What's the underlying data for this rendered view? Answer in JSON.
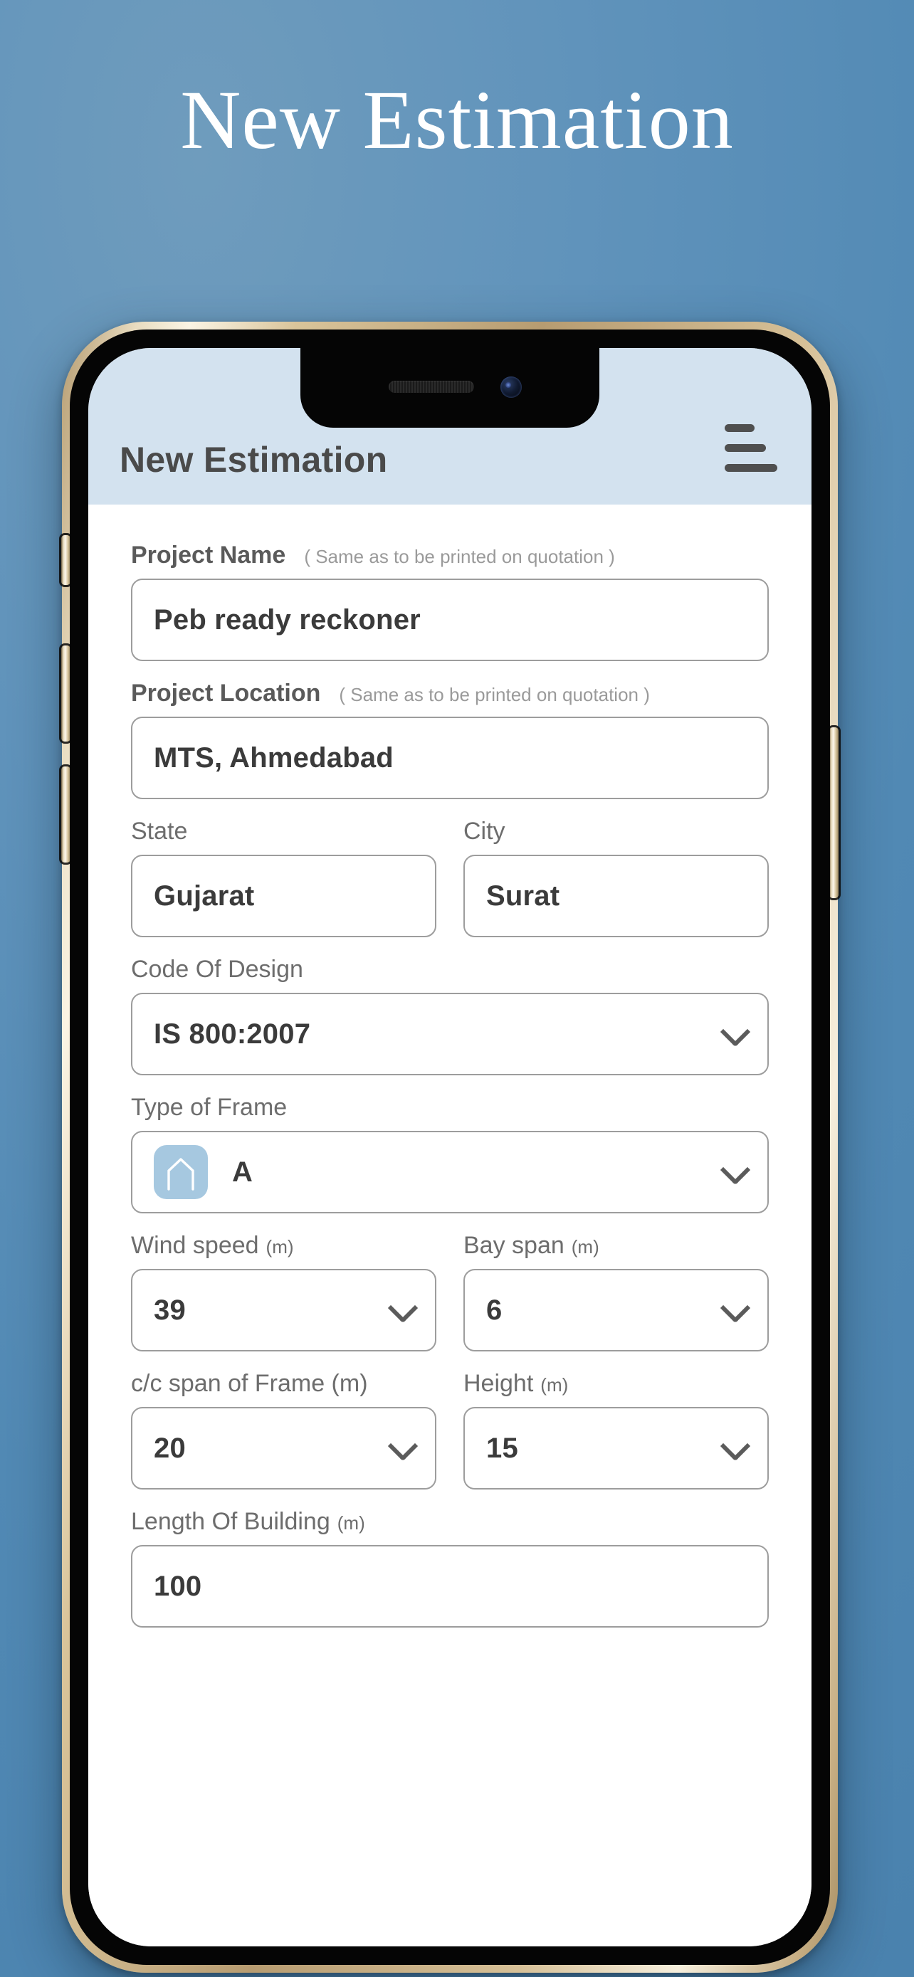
{
  "page": {
    "title": "New Estimation",
    "background_color": "#5189b4",
    "title_color": "#ffffff"
  },
  "device": {
    "frame_color": "#d6c097",
    "bezel_color": "#050505",
    "buttons": [
      "silent-switch",
      "volume-up",
      "volume-down",
      "power"
    ]
  },
  "appbar": {
    "title": "New Estimation",
    "background_color": "#d3e2ef",
    "title_color": "#4a4a4a",
    "menu_icon": "hamburger-icon"
  },
  "form": {
    "accent_color": "#a6c8e0",
    "border_color": "#9d9d9d",
    "fields": [
      {
        "key": "project_name",
        "label": "Project Name",
        "hint": "( Same as to be printed on quotation )",
        "value": "Peb ready reckoner",
        "type": "text"
      },
      {
        "key": "project_location",
        "label": "Project Location",
        "hint": "( Same as to be printed on quotation )",
        "value": "MTS, Ahmedabad",
        "type": "text"
      },
      {
        "key": "state",
        "label": "State",
        "value": "Gujarat",
        "type": "text"
      },
      {
        "key": "city",
        "label": "City",
        "value": "Surat",
        "type": "text"
      },
      {
        "key": "code_of_design",
        "label": "Code Of Design",
        "value": "IS 800:2007",
        "type": "select"
      },
      {
        "key": "type_of_frame",
        "label": "Type of Frame",
        "value": "A",
        "type": "select",
        "icon": "gable-frame-icon"
      },
      {
        "key": "wind_speed",
        "label": "Wind speed",
        "unit": "(m)",
        "value": "39",
        "type": "select"
      },
      {
        "key": "bay_span",
        "label": "Bay span",
        "unit": "(m)",
        "value": "6",
        "type": "select"
      },
      {
        "key": "cc_span_of_frame",
        "label": "c/c span of Frame (m)",
        "value": "20",
        "type": "select"
      },
      {
        "key": "height",
        "label": "Height",
        "unit": "(m)",
        "value": "15",
        "type": "select"
      },
      {
        "key": "length_of_building",
        "label": "Length Of Building",
        "unit": "(m)",
        "value": "100",
        "type": "text"
      }
    ]
  }
}
